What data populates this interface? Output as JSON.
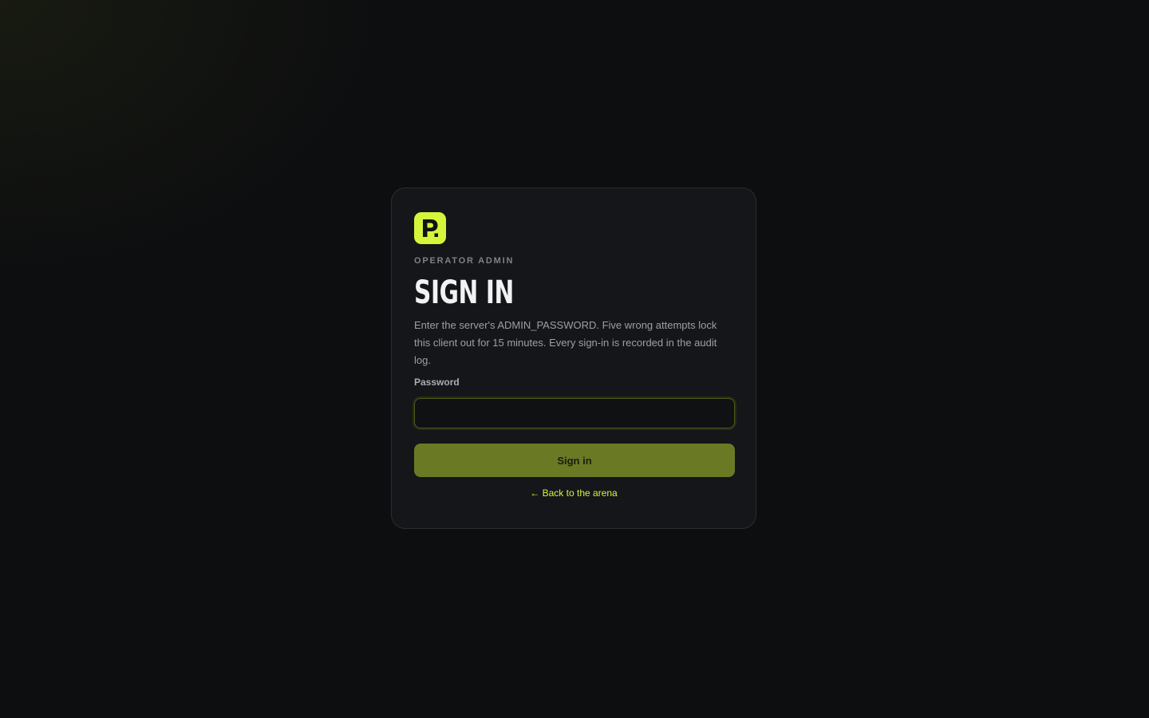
{
  "brand": {
    "logo_letter": "P.",
    "accent_color": "#d4f53a"
  },
  "card": {
    "eyebrow": "OPERATOR ADMIN",
    "title": "SIGN IN",
    "description": "Enter the server's ADMIN_PASSWORD. Five wrong attempts lock this client out for 15 minutes. Every sign-in is recorded in the audit log."
  },
  "form": {
    "password_label": "Password",
    "password_value": "",
    "password_placeholder": "",
    "submit_label": "Sign in"
  },
  "back_link": {
    "label": "← Back to the arena"
  }
}
